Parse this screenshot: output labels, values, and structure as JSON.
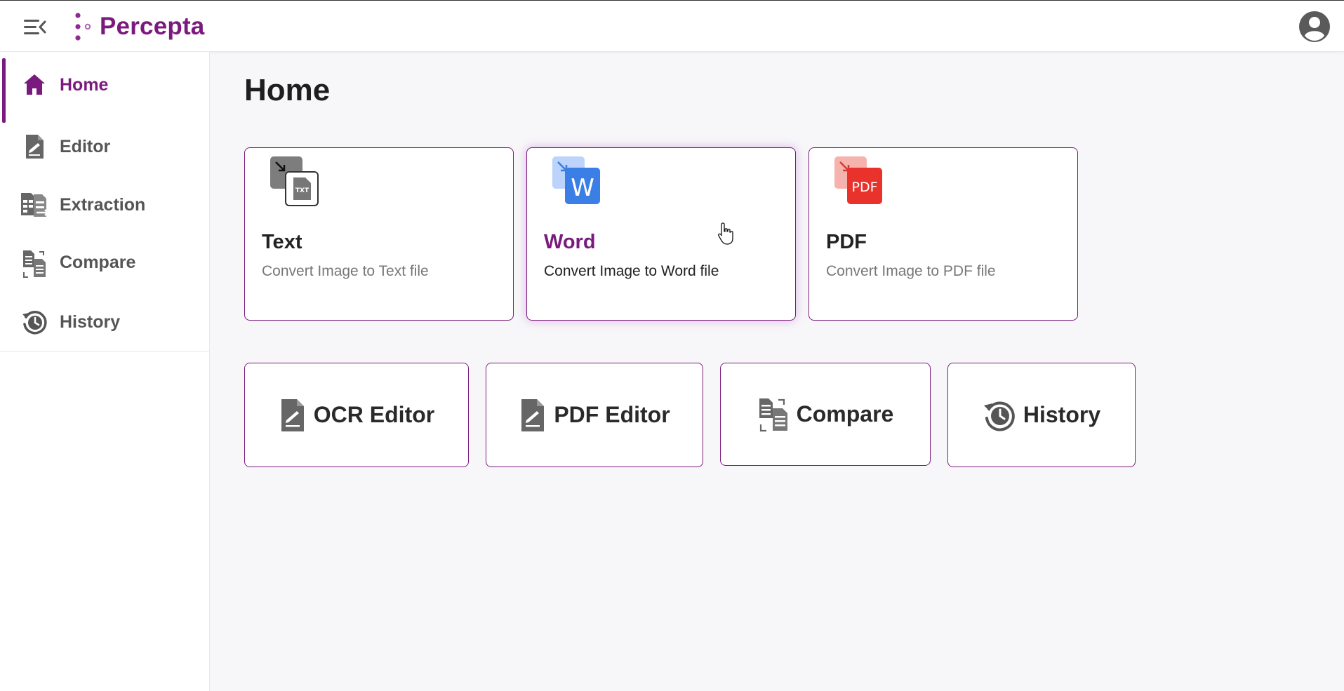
{
  "app": {
    "name": "Percepta",
    "brand_color": "#7b1a7e"
  },
  "sidebar": {
    "items": [
      {
        "label": "Home",
        "icon": "home-icon",
        "active": true
      },
      {
        "label": "Editor",
        "icon": "document-edit-icon",
        "active": false
      },
      {
        "label": "Extraction",
        "icon": "extraction-icon",
        "active": false
      },
      {
        "label": "Compare",
        "icon": "compare-icon",
        "active": false
      },
      {
        "label": "History",
        "icon": "history-icon",
        "active": false
      }
    ]
  },
  "main": {
    "title": "Home",
    "convert_cards": [
      {
        "title": "Text",
        "description": "Convert Image to Text file",
        "icon": "txt-file-icon"
      },
      {
        "title": "Word",
        "description": "Convert Image to Word file",
        "icon": "word-file-icon",
        "hovered": true
      },
      {
        "title": "PDF",
        "description": "Convert Image to PDF file",
        "icon": "pdf-file-icon"
      }
    ],
    "tool_cards": [
      {
        "label": "OCR Editor",
        "icon": "document-edit-icon"
      },
      {
        "label": "PDF Editor",
        "icon": "document-edit-icon"
      },
      {
        "label": "Compare",
        "icon": "compare-icon"
      },
      {
        "label": "History",
        "icon": "history-icon"
      }
    ]
  }
}
